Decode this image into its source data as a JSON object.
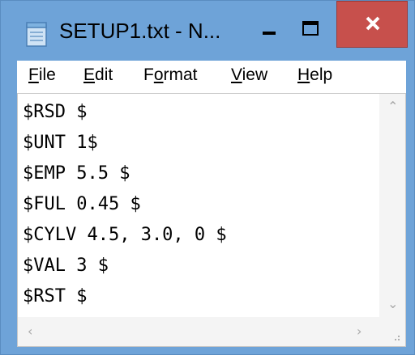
{
  "window": {
    "title": "SETUP1.txt - N...",
    "icon": "notepad-icon",
    "controls": {
      "minimize": "minimize-icon",
      "maximize": "maximize-icon",
      "close": "close-icon"
    }
  },
  "menu": {
    "items": [
      {
        "accel": "F",
        "rest": "ile"
      },
      {
        "accel": "E",
        "rest": "dit"
      },
      {
        "pre": "F",
        "accel": "o",
        "rest": "rmat"
      },
      {
        "accel": "V",
        "rest": "iew"
      },
      {
        "accel": "H",
        "rest": "elp"
      }
    ]
  },
  "document": {
    "lines": [
      "$RSD $",
      "$UNT 1$",
      "$EMP 5.5 $",
      "$FUL 0.45 $",
      "$CYLV 4.5, 3.0, 0 $",
      "$VAL 3 $",
      "$RST $"
    ]
  },
  "colors": {
    "frame": "#6ea3d8",
    "close_button": "#c7504c",
    "editor_bg": "#ffffff"
  }
}
